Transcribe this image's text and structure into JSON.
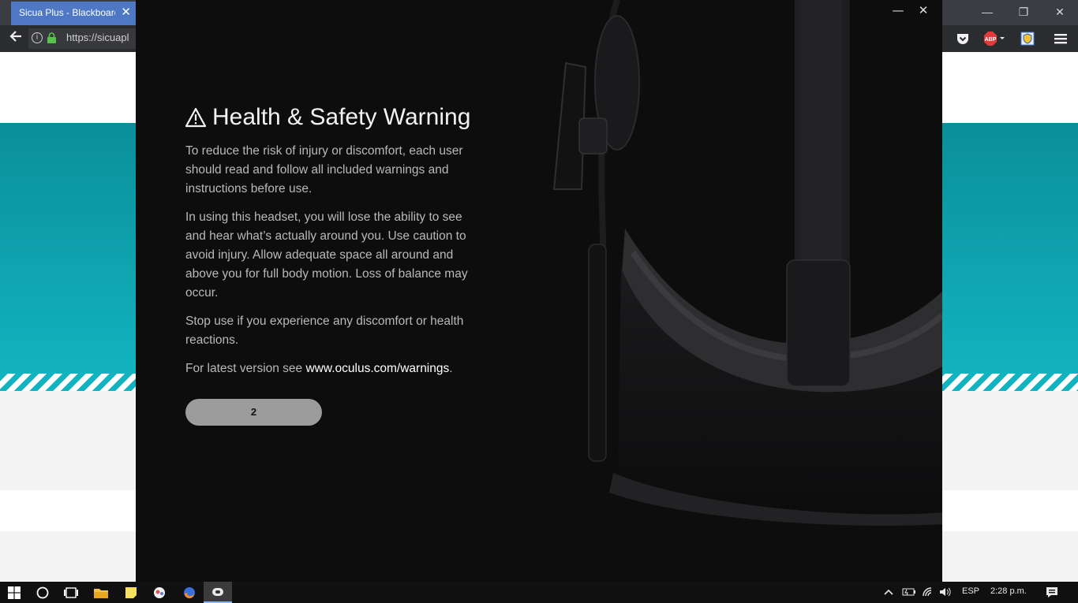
{
  "browser": {
    "tab_title": "Sicua Plus - Blackboard",
    "tab_close": "✕",
    "url": "https://sicuapl",
    "window_controls": {
      "minimize": "—",
      "restore": "❐",
      "close": "✕"
    },
    "toolbar_icons": [
      "pocket-icon",
      "adblock-plus-icon",
      "shield-extension-icon",
      "hamburger-menu-icon"
    ],
    "adblock_label": "ABP"
  },
  "dialog": {
    "controls": {
      "minimize": "—",
      "close": "✕"
    },
    "title": "Health & Safety Warning",
    "paragraphs": [
      "To reduce the risk of injury or discomfort, each user should read and follow all included warnings and instructions before use.",
      "In using this headset, you will lose the ability to see and hear what’s actually around you. Use caution to avoid injury. Allow adequate space all around and above you for full body motion. Loss of balance may occur.",
      "Stop use if you experience any discomfort or health reactions."
    ],
    "latest_prefix": "For latest version see ",
    "latest_link": "www.oculus.com/warnings",
    "latest_suffix": ".",
    "button_label": "2"
  },
  "taskbar": {
    "apps": [
      "windows-start-icon",
      "cortana-icon",
      "task-view-icon",
      "file-explorer-icon",
      "sticky-notes-icon",
      "app-icon",
      "firefox-icon",
      "oculus-icon"
    ],
    "language": "ESP",
    "time": "2:28 p.m."
  },
  "colors": {
    "teal": "#12b3c0",
    "dialog_bg": "#0d0d0e",
    "tab_blue": "#4e78c4",
    "button_gray": "#9c9c9c"
  }
}
